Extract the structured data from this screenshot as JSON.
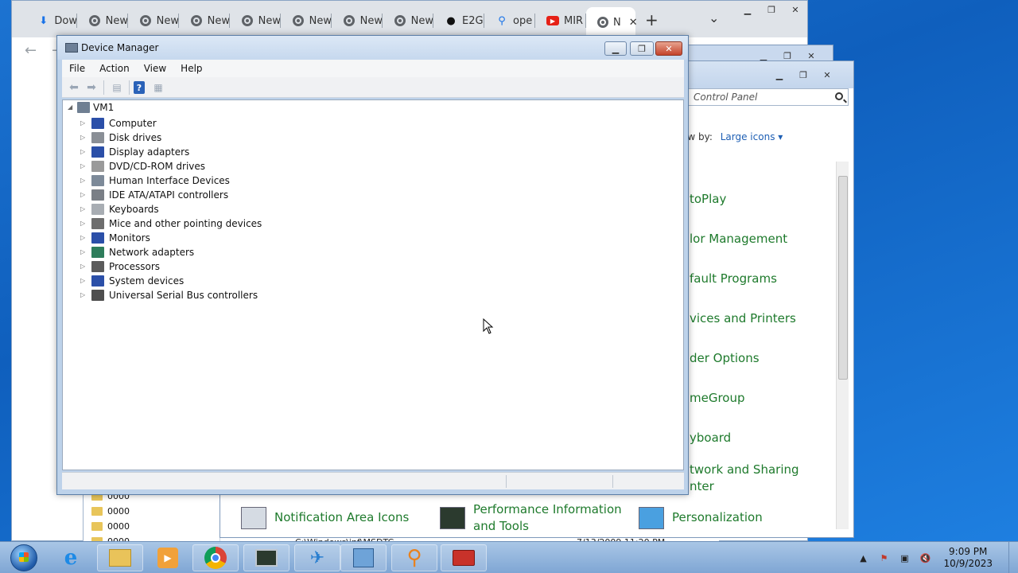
{
  "chrome": {
    "tabs": [
      {
        "label": "Dow",
        "icon": "download-icon"
      },
      {
        "label": "New",
        "icon": "chrome-icon"
      },
      {
        "label": "New",
        "icon": "chrome-icon"
      },
      {
        "label": "New",
        "icon": "chrome-icon"
      },
      {
        "label": "New",
        "icon": "chrome-icon"
      },
      {
        "label": "New",
        "icon": "chrome-icon"
      },
      {
        "label": "New",
        "icon": "chrome-icon"
      },
      {
        "label": "New",
        "icon": "chrome-icon"
      },
      {
        "label": "E2G",
        "icon": "github-icon"
      },
      {
        "label": "ope",
        "icon": "search-icon"
      },
      {
        "label": "MIR",
        "icon": "youtube-icon"
      },
      {
        "label": "N",
        "icon": "chrome-icon"
      }
    ],
    "new_tab": "+",
    "tab_close": "✕",
    "tab_list": "⌄"
  },
  "explorer": {
    "folders": [
      "0000",
      "0000",
      "0000",
      "0000"
    ],
    "path_partial": "C:\\Windows\\inf\\MSDTC",
    "date_partial": "7/13/2009 11:20 PM"
  },
  "control_panel": {
    "search_placeholder": "Control Panel",
    "view_by_label": "ew by:",
    "view_by_value": "Large icons",
    "items_partial": [
      "toPlay",
      "lor Management",
      "fault Programs",
      "vices and Printers",
      "der Options",
      "meGroup",
      "yboard",
      "twork and Sharing",
      "nter"
    ],
    "bottom_items": [
      {
        "label": "Notification Area Icons"
      },
      {
        "label": "Performance Information"
      },
      {
        "label": "and Tools"
      },
      {
        "label": "Personalization"
      }
    ]
  },
  "device_manager": {
    "title": "Device Manager",
    "menu": [
      "File",
      "Action",
      "View",
      "Help"
    ],
    "root": "VM1",
    "devices": [
      {
        "label": "Computer",
        "color": "#2b4fa8"
      },
      {
        "label": "Disk drives",
        "color": "#8a8f96"
      },
      {
        "label": "Display adapters",
        "color": "#2b4fa8"
      },
      {
        "label": "DVD/CD-ROM drives",
        "color": "#9a9a9a"
      },
      {
        "label": "Human Interface Devices",
        "color": "#7d8a99"
      },
      {
        "label": "IDE ATA/ATAPI controllers",
        "color": "#7a7f86"
      },
      {
        "label": "Keyboards",
        "color": "#a8adb3"
      },
      {
        "label": "Mice and other pointing devices",
        "color": "#6d6d6d"
      },
      {
        "label": "Monitors",
        "color": "#2b4fa8"
      },
      {
        "label": "Network adapters",
        "color": "#2e7d5b"
      },
      {
        "label": "Processors",
        "color": "#5b5b5b"
      },
      {
        "label": "System devices",
        "color": "#2b4fa8"
      },
      {
        "label": "Universal Serial Bus controllers",
        "color": "#4e4e4e"
      }
    ]
  },
  "taskbar": {
    "time": "9:09 PM",
    "date": "10/9/2023"
  }
}
